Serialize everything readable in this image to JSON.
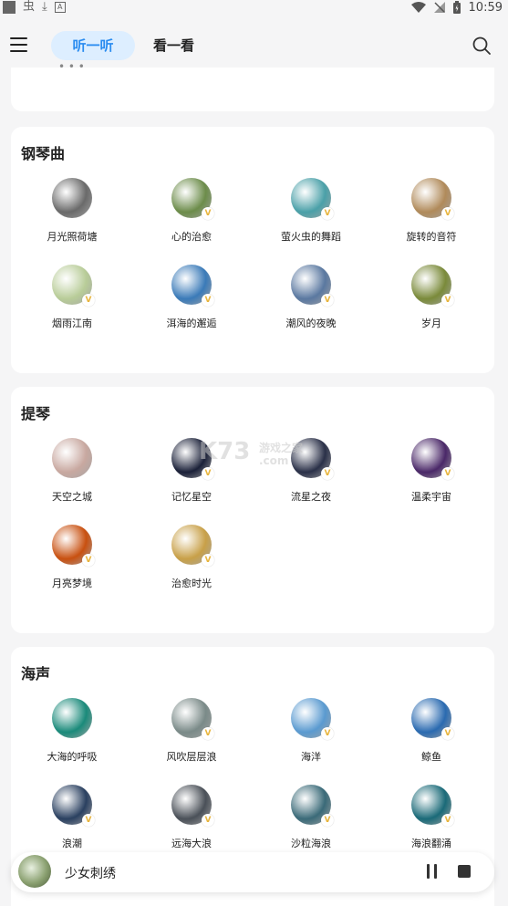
{
  "statusbar": {
    "icon_1": "虫",
    "icon_2": "⤓",
    "icon_3": "A",
    "time": "10:59"
  },
  "header": {
    "tab_listen": "听一听",
    "tab_watch": "看一看"
  },
  "partial_card_text": "• • •",
  "sections": [
    {
      "title": "钢琴曲",
      "items": [
        {
          "label": "月光照荷塘",
          "vip": false,
          "color": "#6a6a6a"
        },
        {
          "label": "心的治愈",
          "vip": true,
          "color": "#6c8c4a"
        },
        {
          "label": "萤火虫的舞蹈",
          "vip": true,
          "color": "#4aa0a8"
        },
        {
          "label": "旋转的音符",
          "vip": true,
          "color": "#b08a5a"
        },
        {
          "label": "烟雨江南",
          "vip": true,
          "color": "#b8cc98"
        },
        {
          "label": "洱海的邂逅",
          "vip": true,
          "color": "#3a7ab8"
        },
        {
          "label": "潮风的夜晚",
          "vip": true,
          "color": "#5a78a0"
        },
        {
          "label": "岁月",
          "vip": true,
          "color": "#7a8a3a"
        }
      ]
    },
    {
      "title": "提琴",
      "items": [
        {
          "label": "天空之城",
          "vip": false,
          "color": "#c8a8a0"
        },
        {
          "label": "记忆星空",
          "vip": true,
          "color": "#1a2038"
        },
        {
          "label": "流星之夜",
          "vip": true,
          "color": "#2a3048"
        },
        {
          "label": "温柔宇宙",
          "vip": true,
          "color": "#4a2868"
        },
        {
          "label": "月亮梦境",
          "vip": true,
          "color": "#c85010"
        },
        {
          "label": "治愈时光",
          "vip": true,
          "color": "#c8a048"
        }
      ]
    },
    {
      "title": "海声",
      "items": [
        {
          "label": "大海的呼吸",
          "vip": false,
          "color": "#1a8a7a"
        },
        {
          "label": "风吹层层浪",
          "vip": true,
          "color": "#7a8a88"
        },
        {
          "label": "海洋",
          "vip": true,
          "color": "#5a9ad0"
        },
        {
          "label": "鲸鱼",
          "vip": true,
          "color": "#2a6ab0"
        },
        {
          "label": "浪潮",
          "vip": true,
          "color": "#2a4060"
        },
        {
          "label": "远海大浪",
          "vip": true,
          "color": "#4a5058"
        },
        {
          "label": "沙粒海浪",
          "vip": true,
          "color": "#3a6a78"
        },
        {
          "label": "海浪翻涌",
          "vip": true,
          "color": "#1a6a78"
        }
      ]
    }
  ],
  "watermark": {
    "brand": "K73",
    "cn": "游戏之家",
    "domain": ".com"
  },
  "player": {
    "title": "少女刺绣"
  },
  "vip_badge": "V"
}
